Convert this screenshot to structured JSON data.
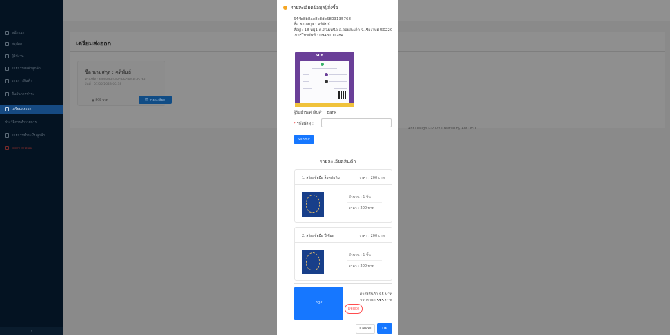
{
  "sidebar": {
    "items": [
      {
        "label": "หน้าแรก"
      },
      {
        "label": "สรุปผล"
      },
      {
        "label": "ผู้ใช้งาน"
      },
      {
        "label": "รายการสินค้าลูกค้า"
      },
      {
        "label": "รายการสินค้า"
      },
      {
        "label": "ยืนยันการชำระ"
      },
      {
        "label": "เตรียมส่งออก"
      },
      {
        "label": "ประวัติการทำรายการ"
      },
      {
        "label": "รายการชำระเงินลูกค้า"
      },
      {
        "label": "ออกจากระบบ"
      }
    ],
    "collapse_label": "‹"
  },
  "page": {
    "title": "เตรียมส่งออก",
    "order_card": {
      "name": "ชื่อ นามสกุล : คทิพันธ์",
      "meta_line1": "คำสั่งซื้อ : 644e8b8ae8c8de5803135768",
      "meta_line2": "วันที่ : 07/05/2023 00:38",
      "price": "595 บาท",
      "detail_button": "รายละเอียด"
    },
    "footer_text": "Ant Design ©2023 Created by Ant UED"
  },
  "modal": {
    "title": "รายละเอียดข้อมูลผู้สั่งซื้อ",
    "buyer": {
      "order_id": "644e8b8ae8c8de5803135768",
      "name": "ชื่อ นามสกุล : คทิพันธ์",
      "address": "ที่อยู่ : 18 หมู่1 ต.ดวงเหนือ อ.ดอยสะเก็ด จ.เชียงใหม่ 50220",
      "phone": "เบอร์โทรศัพท์ : 0948101284"
    },
    "slip_logo": "SCB",
    "transfer": "ผู้รับชำระค่าสินค้า : Bank",
    "tracking_label": "รหัสพัสดุ :",
    "tracking_value": "",
    "submit_label": "Submit",
    "products_title": "รายละเอียดสินค้า",
    "products": [
      {
        "name": "1. สร้อยข้อมือ ล็อคทับทิม",
        "price": "ราคา : 200 บาท",
        "qty": "จำนวน : 1 ชิ้น",
        "subtotal": "ราคา : 200 บาท"
      },
      {
        "name": "2. สร้อยข้อมือ ปี่เซียะ",
        "price": "ราคา : 200 บาท",
        "qty": "จำนวน : 1 ชิ้น",
        "subtotal": "ราคา : 200 บาท"
      }
    ],
    "pdf_label": "PDF",
    "delete_label": "Delete",
    "shipping": "ค่าส่งสินค้า 65 บาท",
    "total_prefix": "รวมราคา",
    "total_value": "595",
    "total_suffix": "บาท",
    "cancel_label": "Cancel",
    "ok_label": "OK"
  },
  "colors": {
    "sidebar_bg": "#041322",
    "active_item": "#164a82",
    "primary": "#1677ff",
    "warning": "#f5a623",
    "danger": "#ff4d4f",
    "slip_purple": "#6a3f98"
  }
}
